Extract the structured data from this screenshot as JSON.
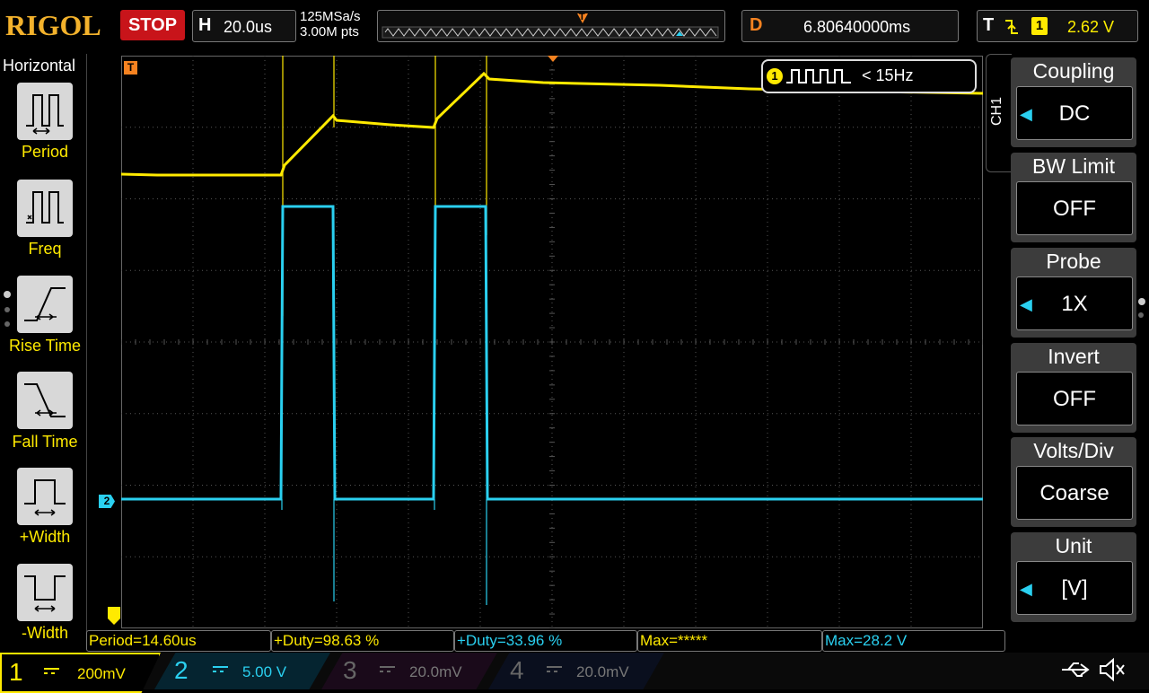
{
  "top_bar": {
    "brand": "RIGOL",
    "run_state": "STOP",
    "horizontal_label": "H",
    "timebase": "20.0us",
    "sample_rate": "125MSa/s",
    "memory_depth": "3.00M pts",
    "trigger_marker": "T",
    "delay_label": "D",
    "delay": "6.80640000ms",
    "trigger_label": "T",
    "trigger_source": "1",
    "trigger_level": "2.62 V"
  },
  "left_menu": {
    "title": "Horizontal",
    "items": [
      {
        "label": "Period",
        "icon": "period-icon"
      },
      {
        "label": "Freq",
        "icon": "frequency-icon"
      },
      {
        "label": "Rise Time",
        "icon": "rise-time-icon"
      },
      {
        "label": "Fall Time",
        "icon": "fall-time-icon"
      },
      {
        "label": "+Width",
        "icon": "positive-width-icon"
      },
      {
        "label": "-Width",
        "icon": "negative-width-icon"
      }
    ]
  },
  "screen": {
    "trigger_marker": "T",
    "ch2_marker": "2",
    "ch1_badge": "1",
    "freq_counter": "< 15Hz",
    "ch1_tag": "CH1"
  },
  "right_menu": {
    "items": [
      {
        "title": "Coupling",
        "value": "DC",
        "arrow": true
      },
      {
        "title": "BW Limit",
        "value": "OFF",
        "arrow": false
      },
      {
        "title": "Probe",
        "value": "1X",
        "arrow": true
      },
      {
        "title": "Invert",
        "value": "OFF",
        "arrow": false
      },
      {
        "title": "Volts/Div",
        "value": "Coarse",
        "arrow": false
      },
      {
        "title": "Unit",
        "value": "[V]",
        "arrow": true
      }
    ]
  },
  "measurements": [
    {
      "text": "Period=14.60us",
      "color": "#ffea00"
    },
    {
      "text": "+Duty=98.63 %",
      "color": "#ffea00"
    },
    {
      "text": "+Duty=33.96 %",
      "color": "#2ad0f0"
    },
    {
      "text": "Max=*****",
      "color": "#ffea00"
    },
    {
      "text": "Max=28.2 V",
      "color": "#2ad0f0"
    }
  ],
  "channels": [
    {
      "num": "1",
      "scale": "200mV",
      "color": "#ffea00",
      "active": true
    },
    {
      "num": "2",
      "scale": "5.00 V",
      "color": "#2ad0f0",
      "active": true
    },
    {
      "num": "3",
      "scale": "20.0mV",
      "color": "#c040c0",
      "active": false
    },
    {
      "num": "4",
      "scale": "20.0mV",
      "color": "#3a70ff",
      "active": false
    }
  ],
  "colors": {
    "ch1": "#ffea00",
    "ch2": "#2ad0f0",
    "trigger": "#f58220",
    "stop": "#c8141a",
    "brand": "#f3b22c"
  }
}
